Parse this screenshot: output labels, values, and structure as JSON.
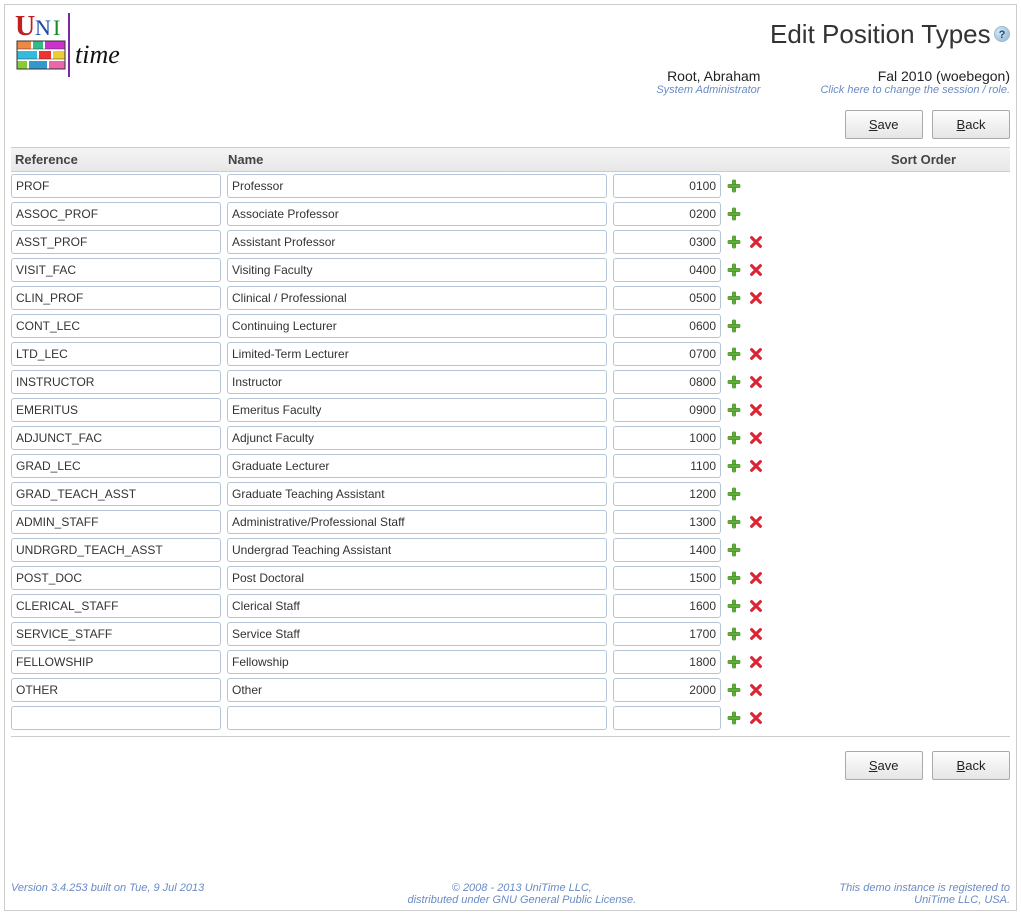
{
  "title": "Edit Position Types",
  "user": {
    "name": "Root, Abraham",
    "role": "System Administrator"
  },
  "session": {
    "name": "Fal 2010 (woebegon)",
    "hint": "Click here to change the session / role."
  },
  "buttons": {
    "save_label": "Save",
    "back_label": "Back",
    "save_ul": "S",
    "save_rest": "ave",
    "back_ul": "B",
    "back_rest": "ack"
  },
  "columns": {
    "reference": "Reference",
    "name": "Name",
    "sort_order": "Sort Order"
  },
  "rows": [
    {
      "ref": "PROF",
      "name": "Professor",
      "sort": "0100",
      "del": false
    },
    {
      "ref": "ASSOC_PROF",
      "name": "Associate Professor",
      "sort": "0200",
      "del": false
    },
    {
      "ref": "ASST_PROF",
      "name": "Assistant Professor",
      "sort": "0300",
      "del": true
    },
    {
      "ref": "VISIT_FAC",
      "name": "Visiting Faculty",
      "sort": "0400",
      "del": true
    },
    {
      "ref": "CLIN_PROF",
      "name": "Clinical / Professional",
      "sort": "0500",
      "del": true
    },
    {
      "ref": "CONT_LEC",
      "name": "Continuing Lecturer",
      "sort": "0600",
      "del": false
    },
    {
      "ref": "LTD_LEC",
      "name": "Limited-Term Lecturer",
      "sort": "0700",
      "del": true
    },
    {
      "ref": "INSTRUCTOR",
      "name": "Instructor",
      "sort": "0800",
      "del": true
    },
    {
      "ref": "EMERITUS",
      "name": "Emeritus Faculty",
      "sort": "0900",
      "del": true
    },
    {
      "ref": "ADJUNCT_FAC",
      "name": "Adjunct Faculty",
      "sort": "1000",
      "del": true
    },
    {
      "ref": "GRAD_LEC",
      "name": "Graduate Lecturer",
      "sort": "1100",
      "del": true
    },
    {
      "ref": "GRAD_TEACH_ASST",
      "name": "Graduate Teaching Assistant",
      "sort": "1200",
      "del": false
    },
    {
      "ref": "ADMIN_STAFF",
      "name": "Administrative/Professional Staff",
      "sort": "1300",
      "del": true
    },
    {
      "ref": "UNDRGRD_TEACH_ASST",
      "name": "Undergrad Teaching Assistant",
      "sort": "1400",
      "del": false
    },
    {
      "ref": "POST_DOC",
      "name": "Post Doctoral",
      "sort": "1500",
      "del": true
    },
    {
      "ref": "CLERICAL_STAFF",
      "name": "Clerical Staff",
      "sort": "1600",
      "del": true
    },
    {
      "ref": "SERVICE_STAFF",
      "name": "Service Staff",
      "sort": "1700",
      "del": true
    },
    {
      "ref": "FELLOWSHIP",
      "name": "Fellowship",
      "sort": "1800",
      "del": true
    },
    {
      "ref": "OTHER",
      "name": "Other",
      "sort": "2000",
      "del": true
    },
    {
      "ref": "",
      "name": "",
      "sort": "",
      "del": true
    }
  ],
  "footer": {
    "left": "Version 3.4.253 built on Tue, 9 Jul 2013",
    "center1": "© 2008 - 2013 UniTime LLC,",
    "center2": "distributed under GNU General Public License.",
    "right1": "This demo instance is registered to",
    "right2": "UniTime LLC, USA."
  },
  "logo_text": "time",
  "logo_uni_u": "U",
  "logo_uni_n": "N",
  "logo_uni_i": "I"
}
